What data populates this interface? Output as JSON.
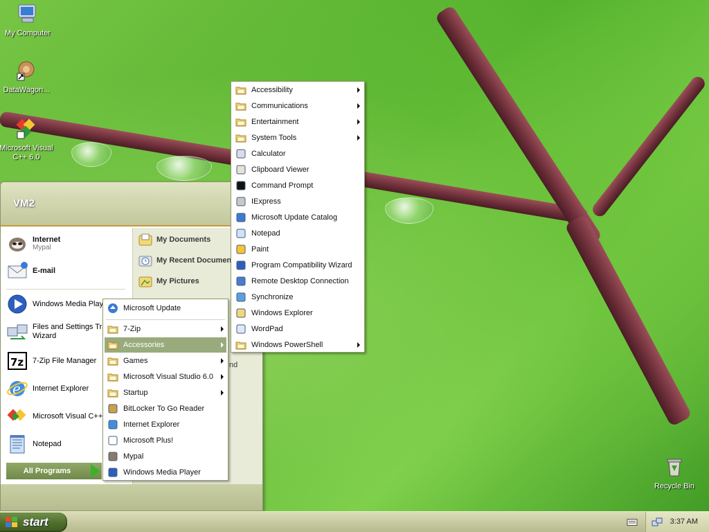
{
  "desktop": {
    "icons": [
      {
        "label": "My Computer"
      },
      {
        "label": "DataWagon..."
      },
      {
        "label": "Microsoft Visual C++ 6.0"
      },
      {
        "label": "Recycle Bin"
      }
    ]
  },
  "start_menu": {
    "user": "VM2",
    "pinned": [
      {
        "title": "Internet",
        "sub": "Mypal"
      },
      {
        "title": "E-mail",
        "sub": ""
      }
    ],
    "recent": [
      "Windows Media Player",
      "Files and Settings Transfer Wizard",
      "7-Zip File Manager",
      "Internet Explorer",
      "Microsoft Visual C++ 6.0",
      "Notepad"
    ],
    "right": [
      "My Documents",
      "My Recent Documents",
      "My Pictures"
    ],
    "all_programs": "All Programs",
    "partial_text": "nd"
  },
  "programs_menu": {
    "top": "Microsoft Update",
    "items": [
      {
        "label": "7-Zip",
        "submenu": true
      },
      {
        "label": "Accessories",
        "submenu": true
      },
      {
        "label": "Games",
        "submenu": true
      },
      {
        "label": "Microsoft Visual Studio 6.0",
        "submenu": true
      },
      {
        "label": "Startup",
        "submenu": true
      },
      {
        "label": "BitLocker To Go Reader",
        "submenu": false
      },
      {
        "label": "Internet Explorer",
        "submenu": false
      },
      {
        "label": "Microsoft Plus!",
        "submenu": false
      },
      {
        "label": "Mypal",
        "submenu": false
      },
      {
        "label": "Windows Media Player",
        "submenu": false
      }
    ]
  },
  "accessories_menu": {
    "items": [
      {
        "label": "Accessibility",
        "submenu": true
      },
      {
        "label": "Communications",
        "submenu": true
      },
      {
        "label": "Entertainment",
        "submenu": true
      },
      {
        "label": "System Tools",
        "submenu": true
      },
      {
        "label": "Calculator",
        "submenu": false
      },
      {
        "label": "Clipboard Viewer",
        "submenu": false
      },
      {
        "label": "Command Prompt",
        "submenu": false
      },
      {
        "label": "IExpress",
        "submenu": false
      },
      {
        "label": "Microsoft Update Catalog",
        "submenu": false
      },
      {
        "label": "Notepad",
        "submenu": false
      },
      {
        "label": "Paint",
        "submenu": false
      },
      {
        "label": "Program Compatibility Wizard",
        "submenu": false
      },
      {
        "label": "Remote Desktop Connection",
        "submenu": false
      },
      {
        "label": "Synchronize",
        "submenu": false
      },
      {
        "label": "Windows Explorer",
        "submenu": false
      },
      {
        "label": "WordPad",
        "submenu": false
      },
      {
        "label": "Windows PowerShell",
        "submenu": true
      }
    ]
  },
  "taskbar": {
    "start_label": "start",
    "clock": "3:37 AM"
  }
}
